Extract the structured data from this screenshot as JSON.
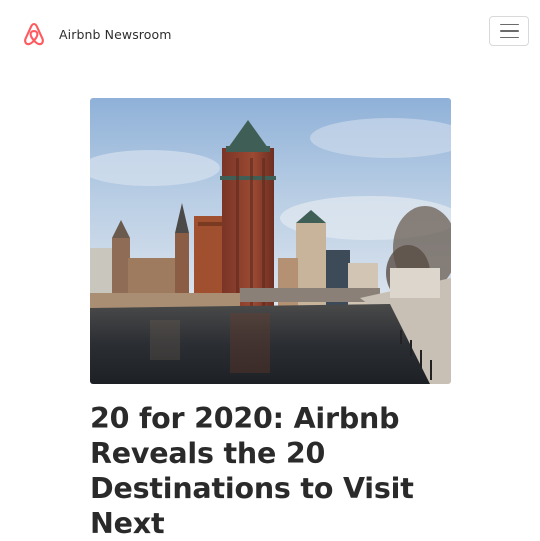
{
  "navbar": {
    "brand_text": "Airbnb Newsroom",
    "logo_icon": "airbnb-belo-icon",
    "menu_icon": "hamburger-menu-icon",
    "brand_color": "#ff5a5f"
  },
  "article": {
    "hero_image": "milwaukee-riverwalk-photo",
    "title": "20 for 2020: Airbnb Reveals the 20 Destinations to Visit Next"
  }
}
